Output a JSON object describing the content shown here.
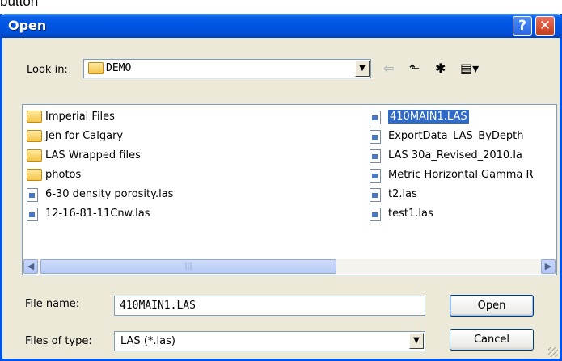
{
  "top_clip": "button",
  "window": {
    "title": "Open",
    "help_label": "?",
    "close_label": "✕"
  },
  "look_in": {
    "label": "Look in:",
    "value": "DEMO",
    "dropdown_glyph": "▼"
  },
  "toolbar": {
    "back_glyph": "⇦",
    "up_glyph": "⬑",
    "new_folder_glyph": "✱",
    "view_glyph": "▤▾"
  },
  "files": {
    "col1": [
      {
        "name": "Imperial Files",
        "type": "folder"
      },
      {
        "name": "Jen for Calgary",
        "type": "folder"
      },
      {
        "name": "LAS Wrapped files",
        "type": "folder"
      },
      {
        "name": "photos",
        "type": "folder"
      },
      {
        "name": "6-30 density porosity.las",
        "type": "file"
      },
      {
        "name": "12-16-81-11Cnw.las",
        "type": "file"
      }
    ],
    "col2": [
      {
        "name": "410MAIN1.LAS",
        "type": "file",
        "selected": true
      },
      {
        "name": "ExportData_LAS_ByDepth",
        "type": "file"
      },
      {
        "name": "LAS 30a_Revised_2010.la",
        "type": "file"
      },
      {
        "name": "Metric Horizontal Gamma R",
        "type": "file"
      },
      {
        "name": "t2.las",
        "type": "file"
      },
      {
        "name": "test1.las",
        "type": "file"
      }
    ]
  },
  "scroll": {
    "left_glyph": "◀",
    "right_glyph": "▶",
    "thumb_grip": "|||"
  },
  "file_name": {
    "label": "File name:",
    "value": "410MAIN1.LAS"
  },
  "file_type": {
    "label": "Files of type:",
    "value": "LAS (*.las)",
    "dropdown_glyph": "▼"
  },
  "buttons": {
    "open": "Open",
    "cancel": "Cancel"
  },
  "colors": {
    "titlebar": "#0054e3",
    "selection": "#316ac5",
    "dialog_bg": "#ece9d8"
  }
}
